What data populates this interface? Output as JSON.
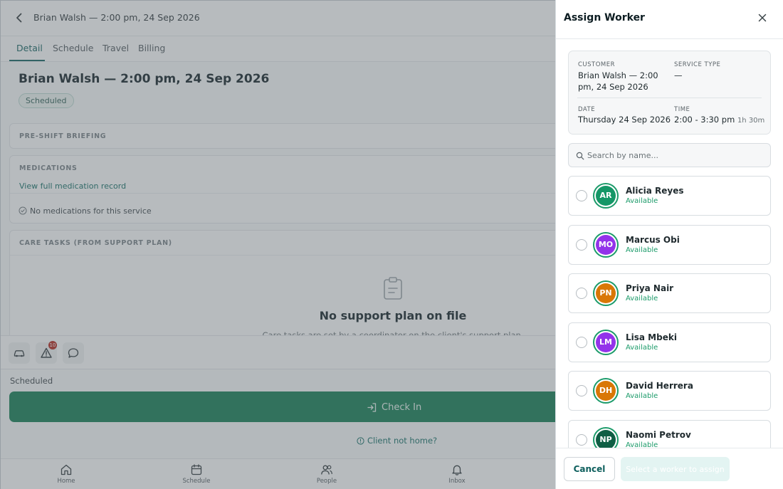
{
  "topbar": {
    "title": "Brian Walsh — 2:00 pm, 24 Sep 2026"
  },
  "tabs": [
    {
      "label": "Detail"
    },
    {
      "label": "Schedule"
    },
    {
      "label": "Travel"
    },
    {
      "label": "Billing"
    }
  ],
  "page": {
    "title": "Brian Walsh — 2:00 pm, 24 Sep 2026",
    "status": "Scheduled"
  },
  "briefing": {
    "label": "PRE-SHIFT BRIEFING"
  },
  "medications": {
    "label": "MEDICATIONS",
    "link": "View full medication record",
    "empty": "No medications for this service"
  },
  "care_tasks": {
    "label": "CARE TASKS (FROM SUPPORT PLAN)",
    "empty_title": "No support plan on file",
    "empty_sub": "Care tasks are set by a coordinator on the client's support plan."
  },
  "action_bar": {
    "alert_count": "10"
  },
  "status_label": "Scheduled",
  "check_in": {
    "label": "Check In"
  },
  "client_not_home": "Client not home?",
  "bottom_nav": [
    {
      "label": "Home",
      "icon": "home-icon"
    },
    {
      "label": "Schedule",
      "icon": "calendar-icon"
    },
    {
      "label": "People",
      "icon": "people-icon"
    },
    {
      "label": "Inbox",
      "icon": "bell-icon"
    }
  ],
  "panel": {
    "title": "Assign Worker",
    "info": {
      "customer_label": "CUSTOMER",
      "customer_value": "Brian Walsh — 2:00 pm, 24 Sep 2026",
      "service_label": "SERVICE TYPE",
      "service_value": "—",
      "date_label": "DATE",
      "date_value": "Thursday 24 Sep 2026",
      "time_label": "TIME",
      "time_value": "2:00 - 3:30 pm",
      "duration": "1h 30m"
    },
    "search": {
      "placeholder": "Search by name..."
    },
    "workers": [
      {
        "initials": "AR",
        "name": "Alicia Reyes",
        "status": "Available",
        "color": "#159767"
      },
      {
        "initials": "MO",
        "name": "Marcus Obi",
        "status": "Available",
        "color": "#9333ea"
      },
      {
        "initials": "PN",
        "name": "Priya Nair",
        "status": "Available",
        "color": "#d97706"
      },
      {
        "initials": "LM",
        "name": "Lisa Mbeki",
        "status": "Available",
        "color": "#9333ea"
      },
      {
        "initials": "DH",
        "name": "David Herrera",
        "status": "Available",
        "color": "#d97706"
      },
      {
        "initials": "NP",
        "name": "Naomi Petrov",
        "status": "Available",
        "color": "#0f5e44"
      }
    ],
    "footer": {
      "cancel": "Cancel",
      "assign": "Select a worker to assign"
    }
  },
  "colors": {
    "accent": "#0e5f5d",
    "primary_button": "#0e7a4f",
    "available": "#1c9b6a"
  }
}
